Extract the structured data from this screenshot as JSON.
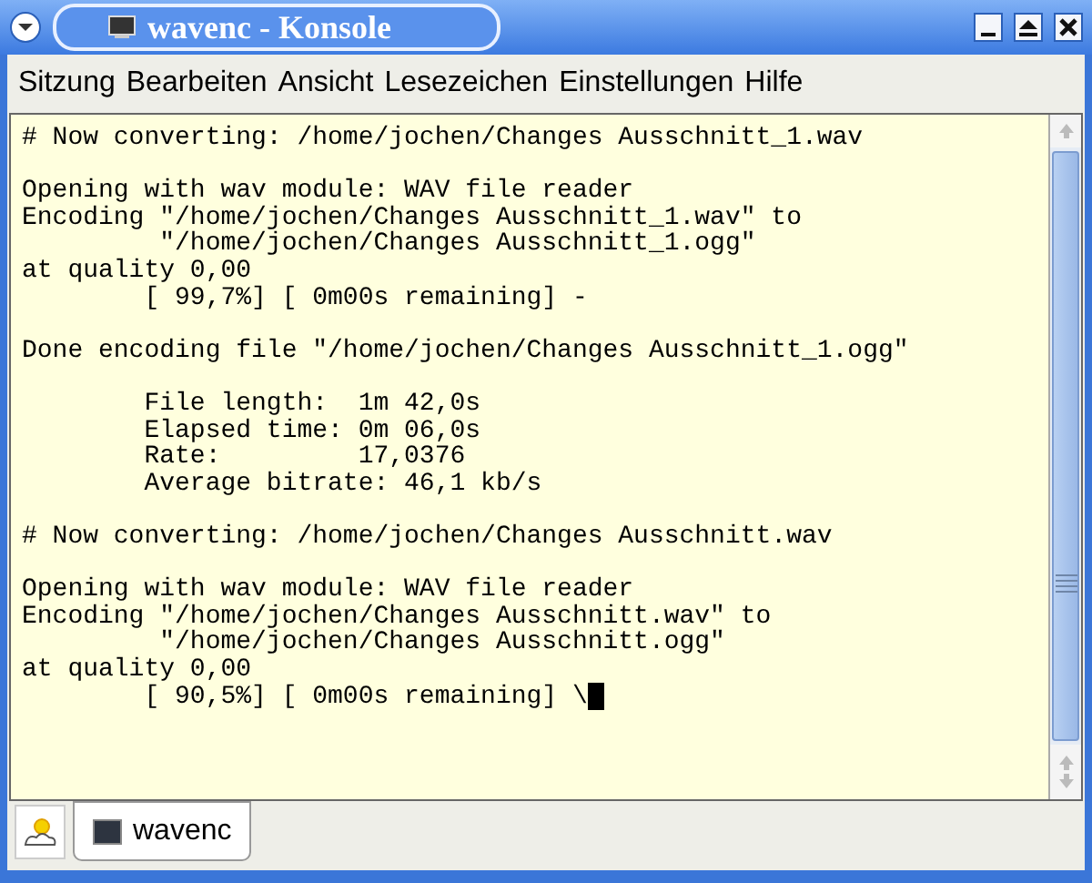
{
  "window": {
    "title": "wavenc - Konsole"
  },
  "menu": [
    "Sitzung",
    "Bearbeiten",
    "Ansicht",
    "Lesezeichen",
    "Einstellungen",
    "Hilfe"
  ],
  "terminal": {
    "blocks": [
      [
        "# Now converting: /home/jochen/Changes Ausschnitt_1.wav"
      ],
      [
        "Opening with wav module: WAV file reader",
        "Encoding \"/home/jochen/Changes Ausschnitt_1.wav\" to",
        "         \"/home/jochen/Changes Ausschnitt_1.ogg\"",
        "at quality 0,00",
        "        [ 99,7%] [ 0m00s remaining] -"
      ],
      [
        "Done encoding file \"/home/jochen/Changes Ausschnitt_1.ogg\""
      ],
      [
        "        File length:  1m 42,0s",
        "        Elapsed time: 0m 06,0s",
        "        Rate:         17,0376",
        "        Average bitrate: 46,1 kb/s"
      ],
      [
        "# Now converting: /home/jochen/Changes Ausschnitt.wav"
      ],
      [
        "Opening with wav module: WAV file reader",
        "Encoding \"/home/jochen/Changes Ausschnitt.wav\" to",
        "         \"/home/jochen/Changes Ausschnitt.ogg\"",
        "at quality 0,00",
        "        [ 90,5%] [ 0m00s remaining] \\"
      ]
    ],
    "cursor": true
  },
  "tabs": [
    {
      "label": "wavenc",
      "selected": true
    }
  ]
}
